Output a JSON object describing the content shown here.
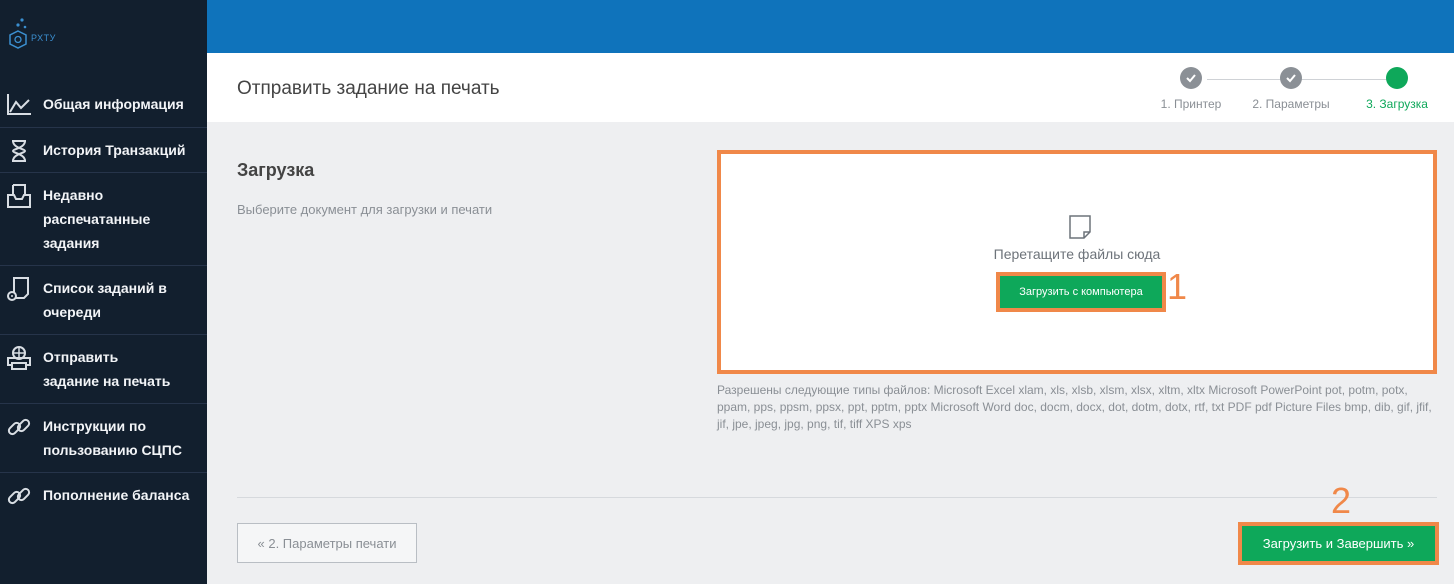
{
  "logo": {
    "text": "РХТУ"
  },
  "sidebar": {
    "items": [
      {
        "label": "Общая информация",
        "icon": "chart-line-icon"
      },
      {
        "label": "История Транзакций",
        "icon": "hourglass-icon"
      },
      {
        "label": "Недавно распечатанные задания",
        "icon": "inbox-icon"
      },
      {
        "label": "Список заданий в очереди",
        "icon": "queue-doc-icon"
      },
      {
        "label": "Отправить задание на печать",
        "icon": "printer-icon"
      },
      {
        "label": "Инструкции по пользованию СЦПС",
        "icon": "link-icon"
      },
      {
        "label": "Пополнение баланса",
        "icon": "link-icon"
      }
    ]
  },
  "header": {
    "title": "Отправить задание на печать"
  },
  "stepper": {
    "steps": [
      {
        "label": "1. Принтер",
        "state": "done"
      },
      {
        "label": "2. Параметры",
        "state": "done"
      },
      {
        "label": "3. Загрузка",
        "state": "active"
      }
    ]
  },
  "upload": {
    "title": "Загрузка",
    "description": "Выберите документ для загрузки и печати",
    "drop_text": "Перетащите файлы сюда",
    "button_label": "Загрузить с компьютера",
    "allowed_types": "Разрешены следующие типы файлов: Microsoft Excel xlam, xls, xlsb, xlsm, xlsx, xltm, xltx Microsoft PowerPoint pot, potm, potx, ppam, pps, ppsm, ppsx, ppt, pptm, pptx Microsoft Word doc, docm, docx, dot, dotm, dotx, rtf, txt PDF pdf Picture Files bmp, dib, gif, jfif, jif, jpe, jpeg, jpg, png, tif, tiff XPS xps"
  },
  "annotations": {
    "mark1": "1",
    "mark2": "2"
  },
  "footer": {
    "back_label": "« 2. Параметры печати",
    "finish_label": "Загрузить и Завершить »"
  },
  "colors": {
    "accent": "#0ea85a",
    "highlight": "#f08849",
    "topbar": "#0f73bb",
    "sidebar": "#121f2e"
  }
}
